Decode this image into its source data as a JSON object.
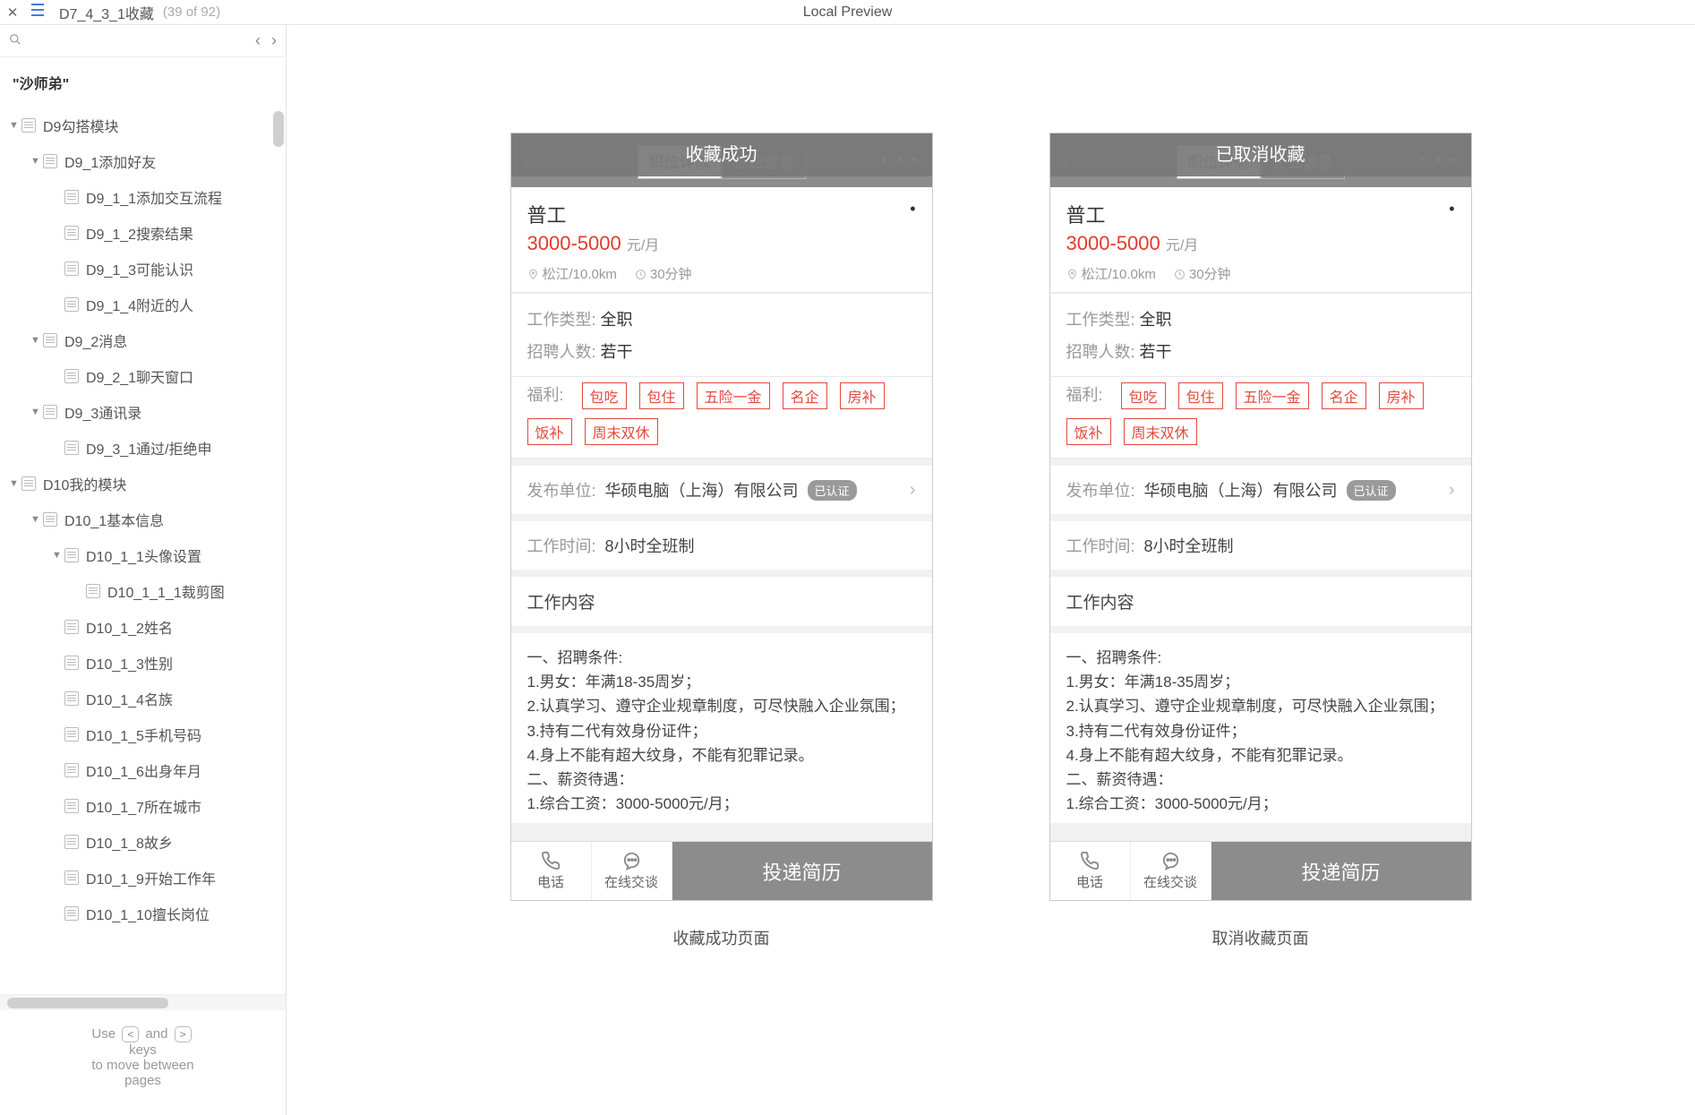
{
  "topbar": {
    "title": "D7_4_3_1收藏",
    "count": "(39 of 92)",
    "center": "Local Preview"
  },
  "sidebar": {
    "filter": "\"沙师弟\"",
    "hint_use": "Use",
    "hint_and": "and",
    "hint_keys": "keys",
    "hint_move": "to move between",
    "hint_pages": "pages",
    "key_left": "<",
    "key_right": ">",
    "items": [
      {
        "indent": 0,
        "caret": "▼",
        "label": "D9勾搭模块"
      },
      {
        "indent": 1,
        "caret": "▼",
        "label": "D9_1添加好友"
      },
      {
        "indent": 2,
        "caret": "",
        "label": "D9_1_1添加交互流程"
      },
      {
        "indent": 2,
        "caret": "",
        "label": "D9_1_2搜索结果"
      },
      {
        "indent": 2,
        "caret": "",
        "label": "D9_1_3可能认识"
      },
      {
        "indent": 2,
        "caret": "",
        "label": "D9_1_4附近的人"
      },
      {
        "indent": 1,
        "caret": "▼",
        "label": "D9_2消息"
      },
      {
        "indent": 2,
        "caret": "",
        "label": "D9_2_1聊天窗口"
      },
      {
        "indent": 1,
        "caret": "▼",
        "label": "D9_3通讯录"
      },
      {
        "indent": 2,
        "caret": "",
        "label": "D9_3_1通过/拒绝申"
      },
      {
        "indent": 0,
        "caret": "▼",
        "label": "D10我的模块"
      },
      {
        "indent": 1,
        "caret": "▼",
        "label": "D10_1基本信息"
      },
      {
        "indent": 2,
        "caret": "▼",
        "label": "D10_1_1头像设置"
      },
      {
        "indent": 3,
        "caret": "",
        "label": "D10_1_1_1裁剪图"
      },
      {
        "indent": 2,
        "caret": "",
        "label": "D10_1_2姓名"
      },
      {
        "indent": 2,
        "caret": "",
        "label": "D10_1_3性别"
      },
      {
        "indent": 2,
        "caret": "",
        "label": "D10_1_4名族"
      },
      {
        "indent": 2,
        "caret": "",
        "label": "D10_1_5手机号码"
      },
      {
        "indent": 2,
        "caret": "",
        "label": "D10_1_6出身年月"
      },
      {
        "indent": 2,
        "caret": "",
        "label": "D10_1_7所在城市"
      },
      {
        "indent": 2,
        "caret": "",
        "label": "D10_1_8故乡"
      },
      {
        "indent": 2,
        "caret": "",
        "label": "D10_1_9开始工作年"
      },
      {
        "indent": 2,
        "caret": "",
        "label": "D10_1_10擅长岗位"
      }
    ]
  },
  "mock": {
    "toast_success": "收藏成功",
    "toast_cancel": "已取消收藏",
    "tab1": "职位详情",
    "tab2": "企业信息",
    "job_title": "普工",
    "salary": "3000-5000",
    "salary_unit": "元/月",
    "loc": "松江/10.0km",
    "time": "30分钟",
    "work_type_lbl": "工作类型:",
    "work_type_val": "全职",
    "hire_lbl": "招聘人数:",
    "hire_val": "若干",
    "benefit_lbl": "福利:",
    "benefits": [
      "包吃",
      "包住",
      "五险一金",
      "名企",
      "房补",
      "饭补",
      "周末双休"
    ],
    "publisher_lbl": "发布单位:",
    "publisher_val": "华硕电脑（上海）有限公司",
    "verified": "已认证",
    "worktime_lbl": "工作时间:",
    "worktime_val": "8小时全班制",
    "content_h": "工作内容",
    "content_body": "一、招聘条件:\n1.男女：年满18-35周岁；\n2.认真学习、遵守企业规章制度，可尽快融入企业氛围；\n3.持有二代有效身份证件；\n4.身上不能有超大纹身，不能有犯罪记录。\n二、薪资待遇：\n1.综合工资：3000-5000元/月；",
    "foot_phone": "电话",
    "foot_chat": "在线交谈",
    "foot_submit": "投递简历",
    "caption_success": "收藏成功页面",
    "caption_cancel": "取消收藏页面"
  }
}
